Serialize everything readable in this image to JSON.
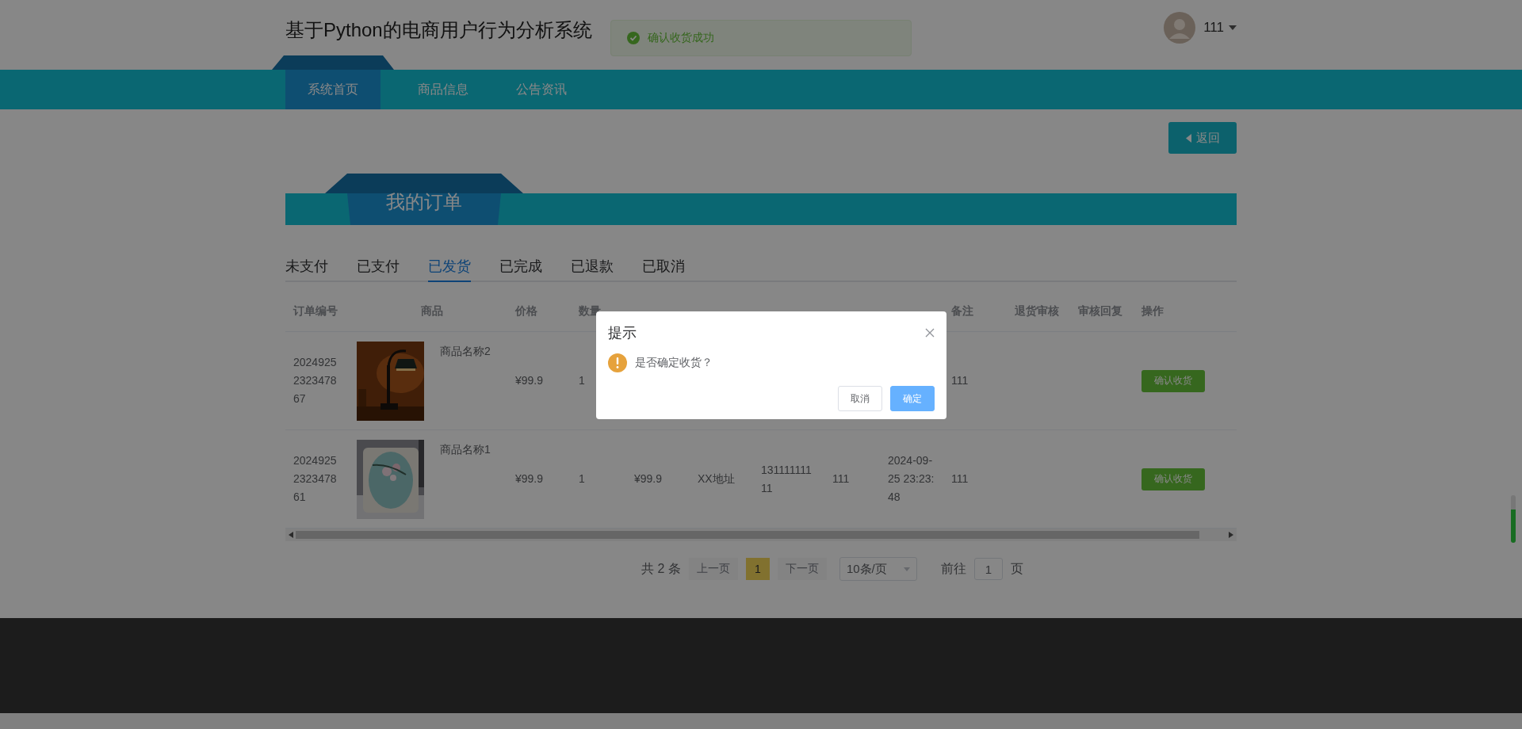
{
  "header": {
    "title": "基于Python的电商用户行为分析系统",
    "user": "111"
  },
  "toast": {
    "message": "确认收货成功"
  },
  "nav": [
    {
      "label": "系统首页",
      "selected": true
    },
    {
      "label": "商品信息",
      "selected": false
    },
    {
      "label": "公告资讯",
      "selected": false
    }
  ],
  "back_button": "返回",
  "section_title": "我的订单",
  "order_tabs": [
    {
      "label": "未支付",
      "selected": false
    },
    {
      "label": "已支付",
      "selected": false
    },
    {
      "label": "已发货",
      "selected": true
    },
    {
      "label": "已完成",
      "selected": false
    },
    {
      "label": "已退款",
      "selected": false
    },
    {
      "label": "已取消",
      "selected": false
    }
  ],
  "table": {
    "columns": [
      "订单编号",
      "商品",
      "价格",
      "数量",
      null,
      null,
      null,
      null,
      null,
      "备注",
      "退货审核",
      "审核回复",
      "操作"
    ],
    "rows": [
      {
        "order_no": "2024925232347867",
        "product": {
          "kind": "picture",
          "name": "商品名称2"
        },
        "price": "¥99.9",
        "quantity": "1",
        "note": "111",
        "action": "确认收货"
      },
      {
        "order_no": "2024925232347861",
        "product": {
          "kind": "picture",
          "name": "商品名称1"
        },
        "price": "¥99.9",
        "quantity": "1",
        "total": "¥99.9",
        "address": "XX地址",
        "phone": "13111111111",
        "column_8": "111",
        "time": "2024-09-25 23:23:48",
        "note": "111",
        "action": "确认收货"
      }
    ]
  },
  "pagination": {
    "total": "共 2 条",
    "prev": {
      "label": "上一页",
      "disabled": true
    },
    "pages": [
      {
        "label": "1",
        "selected": true
      }
    ],
    "next": {
      "label": "下一页",
      "disabled": true
    },
    "page_size": "10条/页",
    "goto_label": "前往",
    "goto_value": "1",
    "goto_suffix": "页"
  },
  "dialog": {
    "title": "提示",
    "message": "是否确定收货？",
    "cancel": "取消",
    "confirm": "确定"
  }
}
